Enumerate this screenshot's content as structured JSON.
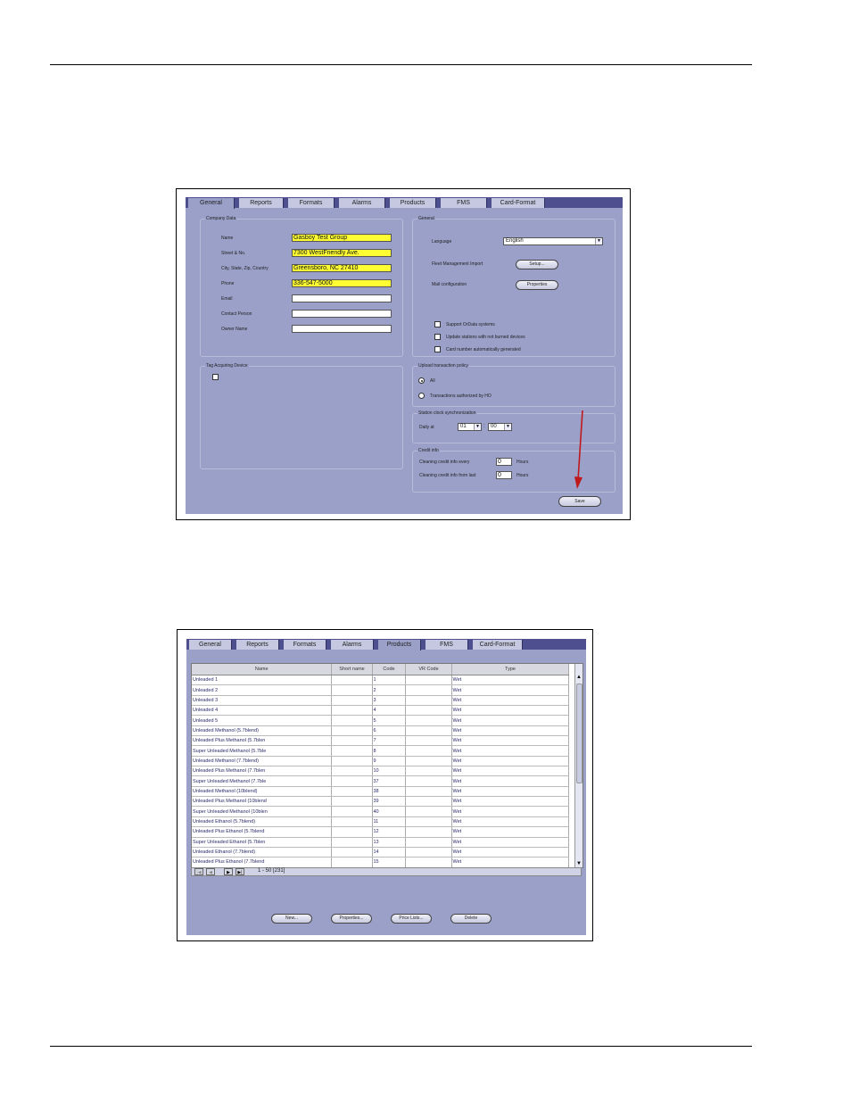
{
  "screen1": {
    "tabs": [
      "General",
      "Reports",
      "Formats",
      "Alarms",
      "Products",
      "FMS",
      "Card-Format"
    ],
    "active_tab": "General",
    "company_data": {
      "title": "Company Data",
      "fields": [
        {
          "label": "Name",
          "value": "Gasboy Test Group",
          "highlight": true
        },
        {
          "label": "Street & No.",
          "value": "7300 WestFriendly Ave.",
          "highlight": true
        },
        {
          "label": "City, State, Zip, Country",
          "value": "Greensboro, NC 27410",
          "highlight": true
        },
        {
          "label": "Phone",
          "value": "336-547-5000",
          "highlight": true
        },
        {
          "label": "Email",
          "value": "",
          "highlight": false
        },
        {
          "label": "Contact Person",
          "value": "",
          "highlight": false
        },
        {
          "label": "Owner Name",
          "value": "",
          "highlight": false
        }
      ]
    },
    "general": {
      "title": "General",
      "language_label": "Language",
      "language_value": "English",
      "fleet_label": "Fleet Management Import",
      "fleet_button": "Setup...",
      "mail_label": "Mail configuration",
      "mail_button": "Properties",
      "checkboxes": [
        "Support OrData systems",
        "Update stations with not burned devices",
        "Card number automatically generated"
      ]
    },
    "tag": {
      "title": "Tag Acquiring Device"
    },
    "upload": {
      "title": "Upload transaction policy",
      "options": [
        "All",
        "Transactions authorized by HO"
      ],
      "selected": "All"
    },
    "clock": {
      "title": "Station clock synchronization",
      "label": "Daily at",
      "hour": "01",
      "sep": ":",
      "minute": "00"
    },
    "credit": {
      "title": "Credit info",
      "rows": [
        {
          "label": "Cleaning credit info every",
          "value": "0",
          "unit": "Hours"
        },
        {
          "label": "Cleaning credit info from last",
          "value": "0",
          "unit": "Hours"
        }
      ]
    },
    "save_button": "Save",
    "arrow_color": "#c0191b"
  },
  "screen2": {
    "tabs": [
      "General",
      "Reports",
      "Formats",
      "Alarms",
      "Products",
      "FMS",
      "Card-Format"
    ],
    "active_tab": "Products",
    "columns": [
      "Name",
      "Short name",
      "Code",
      "VR Code",
      "Type"
    ],
    "rows": [
      [
        "Unleaded 1",
        "",
        "1",
        "",
        "Wet"
      ],
      [
        "Unleaded 2",
        "",
        "2",
        "",
        "Wet"
      ],
      [
        "Unleaded 3",
        "",
        "3",
        "",
        "Wet"
      ],
      [
        "Unleaded 4",
        "",
        "4",
        "",
        "Wet"
      ],
      [
        "Unleaded 5",
        "",
        "5",
        "",
        "Wet"
      ],
      [
        "Unleaded Methanol (5.7blend)",
        "",
        "6",
        "",
        "Wet"
      ],
      [
        "Unleaded Plus Methanol (5.7blen",
        "",
        "7",
        "",
        "Wet"
      ],
      [
        "Super Unleaded Methanol (5.7ble",
        "",
        "8",
        "",
        "Wet"
      ],
      [
        "Unleaded Methanol (7.7blend)",
        "",
        "9",
        "",
        "Wet"
      ],
      [
        "Unleaded Plus Methanol (7.7blen",
        "",
        "10",
        "",
        "Wet"
      ],
      [
        "Super Unleaded Methanol (7.7ble",
        "",
        "37",
        "",
        "Wet"
      ],
      [
        "Unleaded Methanol (10blend)",
        "",
        "38",
        "",
        "Wet"
      ],
      [
        "Unleaded Plus Methanol (10blend",
        "",
        "39",
        "",
        "Wet"
      ],
      [
        "Super Unleaded Methanol (10blen",
        "",
        "40",
        "",
        "Wet"
      ],
      [
        "Unleaded Ethanol (5.7blend)",
        "",
        "11",
        "",
        "Wet"
      ],
      [
        "Unleaded Plus Ethanol (5.7blend",
        "",
        "12",
        "",
        "Wet"
      ],
      [
        "Super Unleaded Ethanol (5.7blen",
        "",
        "13",
        "",
        "Wet"
      ],
      [
        "Unleaded Ethanol (7.7blend)",
        "",
        "14",
        "",
        "Wet"
      ],
      [
        "Unleaded Plus Ethanol (7.7blend",
        "",
        "15",
        "",
        "Wet"
      ],
      [
        "Super Unleaded Ethanol (7.7blen",
        "",
        "41",
        "",
        "Wet"
      ],
      [
        "Unleaded Ethanol (10blend)",
        "",
        "42",
        "",
        "Wet"
      ]
    ],
    "pager_text": "1 - 50  [231]",
    "buttons": [
      "New...",
      "Properties...",
      "Price Lists...",
      "Delete"
    ]
  }
}
